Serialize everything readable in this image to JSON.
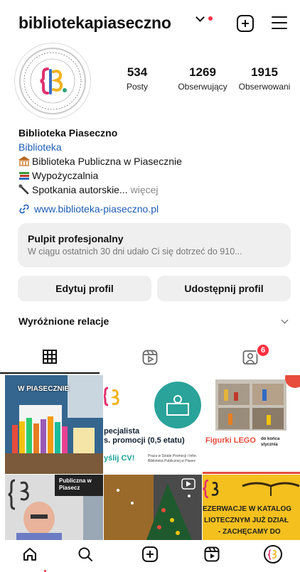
{
  "header": {
    "username": "bibliotekapiaseczno"
  },
  "profile": {
    "stats": [
      {
        "value": "534",
        "label": "Posty"
      },
      {
        "value": "1269",
        "label": "Obserwujący"
      },
      {
        "value": "1915",
        "label": "Obserwowani"
      }
    ],
    "name": "Biblioteka Piaseczno",
    "category": "Biblioteka",
    "bio_lines": [
      "Biblioteka Publiczna w Piasecznie",
      "Wypożyczalnia",
      "Spotkania autorskie..."
    ],
    "more_label": "więcej",
    "link": "www.biblioteka-piaseczno.pl"
  },
  "dashboard": {
    "title": "Pulpit profesjonalny",
    "subtitle": "W ciągu ostatnich 30 dni udało Ci się dotrzeć do 910..."
  },
  "actions": {
    "edit_label": "Edytuj profil",
    "share_label": "Udostępnij profil"
  },
  "highlights": {
    "title": "Wyróżnione relacje"
  },
  "tabs": {
    "tagged_badge": "6"
  },
  "posts": {
    "p1_text": "W PIASECZNIE",
    "p2_text_1": "pecjalista",
    "p2_text_2": "s. promocji (0,5 etatu)",
    "p2_text_3": "yślij CV!",
    "p2_text_4": "Praca w Dziale Promocji i Infor. Biblioteka Publicznej w Piasec",
    "p3_text_1": "Figurki LEGO",
    "p3_text_2": "do końca stycznia",
    "p4_text": "Publiczna w Piasecz",
    "p6_text_1": "EZERWACJE W KATALOG",
    "p6_text_2": "LIOTECZNYM JUŻ DZIAŁ",
    "p6_text_3": "- ZACHĘCAMY DO"
  },
  "colors": {
    "accent_red": "#ff3040",
    "link_blue": "#1d5cb3",
    "button_gray": "#efefef"
  }
}
